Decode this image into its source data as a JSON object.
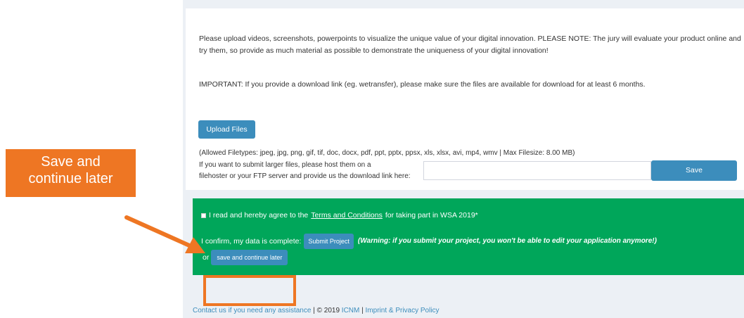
{
  "upload_section": {
    "description": "Please upload videos, screenshots, powerpoints to visualize the unique value of your digital innovation. PLEASE NOTE: The jury will evaluate your product online and try them, so provide as much material as possible to demonstrate the uniqueness of your digital innovation!",
    "description_line1": "Please upload videos, screenshots, powerpoints to visualize the unique value of your digital innovation. PLEASE NOTE: The jury will evaluate your product online and",
    "description_line2": "try them, so provide as much material as possible to demonstrate the uniqueness of your digital innovation!",
    "important": "IMPORTANT: If you provide a download link (eg. wetransfer), please make sure the files are available for download for at least 6 months.",
    "upload_button": "Upload Files",
    "allowed_filetypes": "(Allowed Filetypes: jpeg, jpg, png, gif, tif, doc, docx, pdf, ppt, pptx, ppsx, xls, xlsx, avi, mp4, wmv | Max Filesize: 8.00 MB)",
    "large_files_line1": "If you want to submit larger files, please host them on a",
    "large_files_line2": "filehoster or your FTP server and provide us the download link here:",
    "link_input_value": "",
    "save_button": "Save"
  },
  "submission": {
    "agree_prefix": "I read and hereby agree to the",
    "terms_link": "Terms and Conditions",
    "agree_suffix": "for taking part in WSA 2019*",
    "agree_checked": false,
    "confirm_text": "I confirm, my data is complete:",
    "submit_button": "Submit Project",
    "warning": "(Warning: if you submit your project, you won't be able to edit your application anymore!)",
    "or_text": "or",
    "save_later_button": "save and continue later"
  },
  "footer": {
    "contact_link": "Contact us if you need any assistance",
    "separator1": "|",
    "copyright": "© 2019",
    "icnm_link": "ICNM",
    "separator2": "|",
    "imprint_link": "Imprint & Privacy Policy"
  },
  "annotation": {
    "callout_text": "Save and continue later",
    "callout_line1": "Save and",
    "callout_line2": "continue later",
    "accent_color": "#ee7623"
  },
  "colors": {
    "primary_button": "#3c8dbc",
    "submission_box": "#00a65a",
    "page_background": "#ecf0f5"
  }
}
